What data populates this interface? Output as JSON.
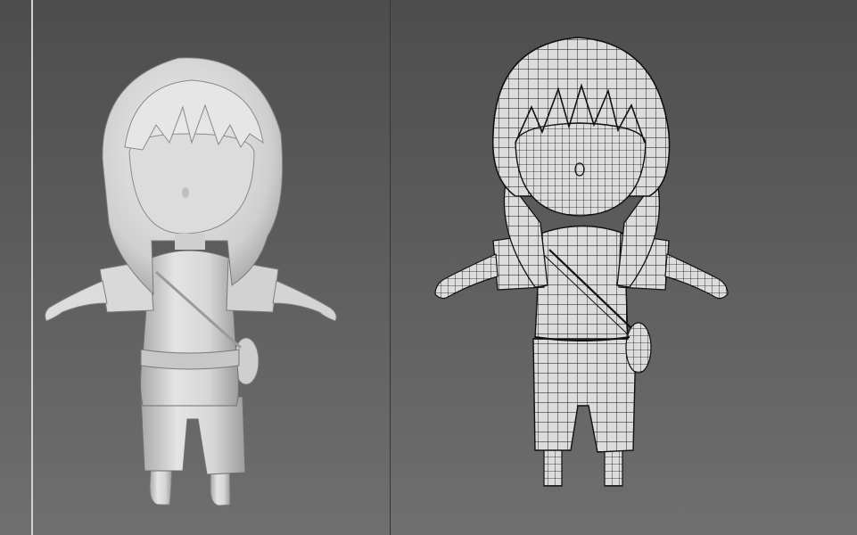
{
  "viewports": [
    {
      "id": "left",
      "mode": "shaded"
    },
    {
      "id": "right",
      "mode": "wireframe"
    }
  ],
  "colors": {
    "background_top": "#4d4d4d",
    "background_bottom": "#6f6f6f",
    "model_shade": "#d6d6d6",
    "wire": "#111111",
    "active_border": "#d2d2d2"
  },
  "model": {
    "name_icon": "chibi-character-icon"
  }
}
